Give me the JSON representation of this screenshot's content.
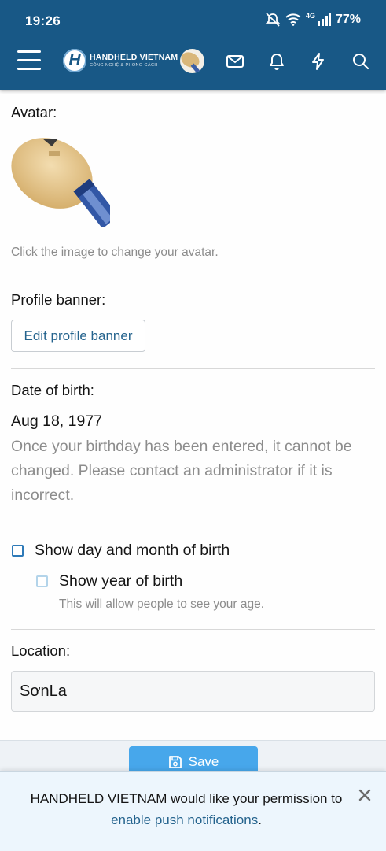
{
  "status_bar": {
    "time": "19:26",
    "network": "4G",
    "battery": "77%"
  },
  "header": {
    "logo_letter": "H",
    "logo_name": "HANDHELD VIETNAM",
    "logo_tagline": "CÔNG NGHỆ & PHONG CÁCH",
    "icons": [
      "menu-icon",
      "envelope-icon",
      "bell-icon",
      "bolt-icon",
      "search-icon"
    ]
  },
  "avatar": {
    "label": "Avatar:",
    "hint": "Click the image to change your avatar."
  },
  "banner": {
    "label": "Profile banner:",
    "button": "Edit profile banner"
  },
  "dob": {
    "label": "Date of birth:",
    "value": "Aug 18, 1977",
    "note": "Once your birthday has been entered, it cannot be changed. Please contact an administrator if it is incorrect.",
    "show_day_month": "Show day and month of birth",
    "show_year": "Show year of birth",
    "show_year_hint": "This will allow people to see your age."
  },
  "location": {
    "label": "Location:",
    "value": "SơnLa"
  },
  "actions": {
    "save": "Save"
  },
  "notice": {
    "text": "HANDHELD VIETNAM would like your permission to",
    "link": "enable push notifications",
    "suffix": "."
  },
  "colors": {
    "header": "#185886",
    "link": "#24638d",
    "save": "#47a7eb",
    "notice_bg": "#edf6fd"
  }
}
